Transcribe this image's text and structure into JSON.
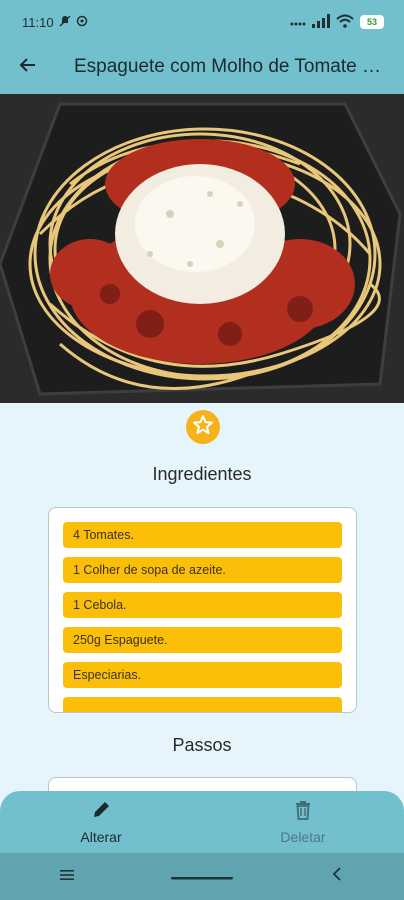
{
  "status_bar": {
    "time": "11:10",
    "battery": "53"
  },
  "app_bar": {
    "title": "Espaguete com Molho de Tomate e Carne",
    "back_icon": "arrow-left-icon"
  },
  "hero": {
    "image_subject": "spaghetti-bolognese-photo"
  },
  "favorite": {
    "icon": "star-icon",
    "color": "#f5b21b"
  },
  "ingredients": {
    "title": "Ingredientes",
    "items": [
      "4 Tomates.",
      "1 Colher de sopa de azeite.",
      "1 Cebola.",
      "250g Espaguete.",
      "Especiarias."
    ]
  },
  "steps": {
    "title": "Passos"
  },
  "bottom_actions": {
    "edit_label": "Alterar",
    "edit_icon": "pencil-icon",
    "delete_label": "Deletar",
    "delete_icon": "trash-icon"
  },
  "colors": {
    "header": "#72c0cd",
    "background": "#e6f4fb",
    "ingredient_chip": "#fbbf09",
    "nav_bar": "#5fa4af"
  }
}
